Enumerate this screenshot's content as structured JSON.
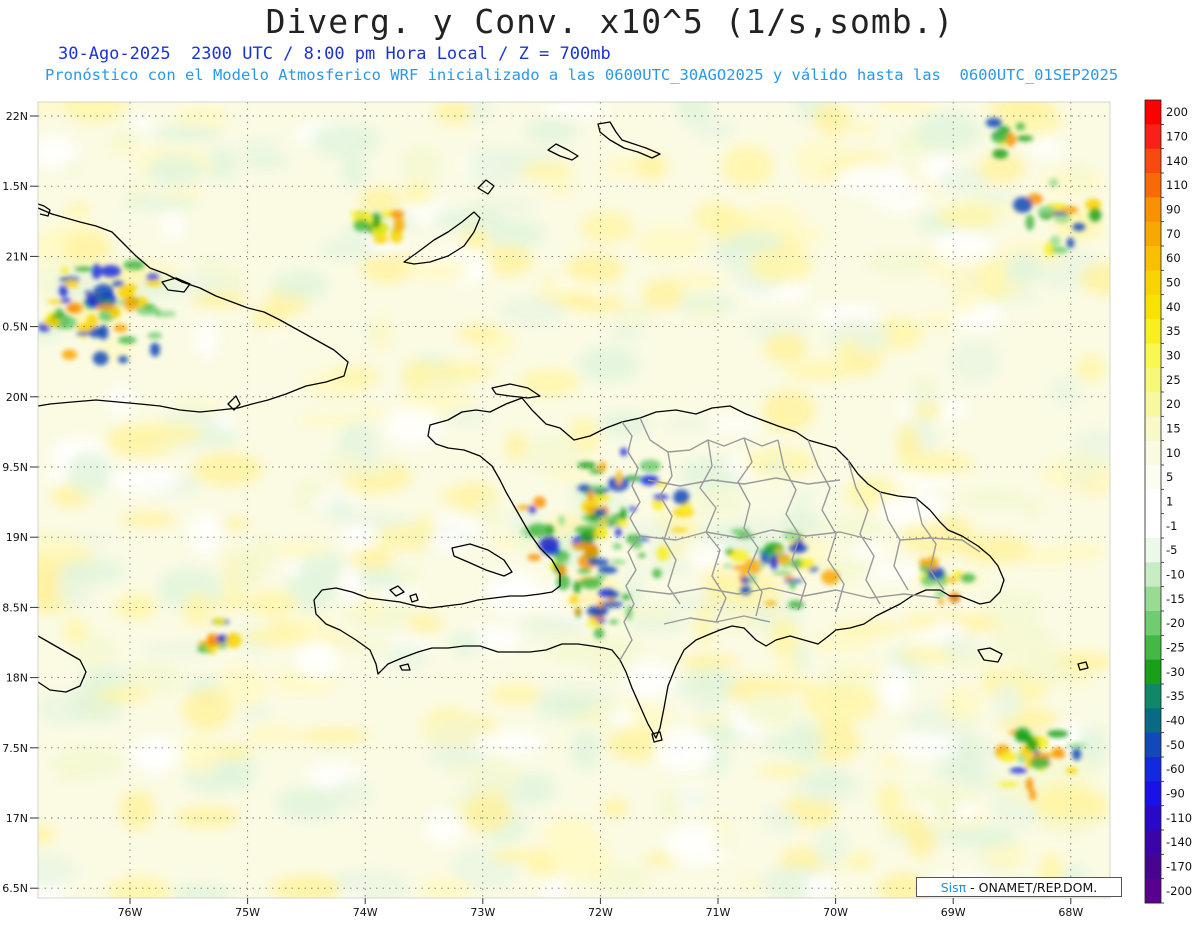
{
  "title": "Diverg. y Conv. x10^5 (1/s,somb.)",
  "subtitle_line1": "30-Ago-2025  2300 UTC / 8:00 pm Hora Local / Z = 700mb",
  "subtitle_line2": "Pronóstico con el Modelo Atmosferico WRF inicializado a las 0600UTC_30AGO2025 y válido hasta las  0600UTC_01SEP2025",
  "lat_ticks": [
    "22N",
    "1.5N",
    "21N",
    "0.5N",
    "20N",
    "9.5N",
    "19N",
    "8.5N",
    "18N",
    "7.5N",
    "17N",
    "6.5N"
  ],
  "lon_ticks": [
    "76W",
    "75W",
    "74W",
    "73W",
    "72W",
    "71W",
    "70W",
    "69W",
    "68W"
  ],
  "colorbar": {
    "labels": [
      "200",
      "170",
      "140",
      "110",
      "90",
      "70",
      "60",
      "50",
      "40",
      "35",
      "30",
      "25",
      "20",
      "15",
      "10",
      "5",
      "1",
      "-1",
      "-5",
      "-10",
      "-15",
      "-20",
      "-25",
      "-30",
      "-35",
      "-40",
      "-50",
      "-60",
      "-90",
      "-110",
      "-140",
      "-170",
      "-200"
    ],
    "colors": [
      "#ff0000",
      "#f82018",
      "#f84a10",
      "#f86a08",
      "#f89000",
      "#f8a800",
      "#f8c000",
      "#f8d400",
      "#f8e200",
      "#f8ee20",
      "#f8f850",
      "#f8f878",
      "#f8f8a0",
      "#f8f8c8",
      "#fafae0",
      "#fcfcf0",
      "#ffffff",
      "#ffffff",
      "#ecf8ea",
      "#c8ecc4",
      "#98dc94",
      "#70cc70",
      "#44b844",
      "#18a018",
      "#108868",
      "#0a6a86",
      "#1248b8",
      "#1428e0",
      "#1a10e8",
      "#2a08c8",
      "#3a04a8",
      "#480490",
      "#5a0090"
    ]
  },
  "credit": {
    "brand": "Sisπ",
    "rest": " - ONAMET/REP.DOM."
  },
  "colors": {
    "background_field": "#fbfbe2",
    "coast": "#000000",
    "provinces": "#999999",
    "grid": "#888888"
  }
}
